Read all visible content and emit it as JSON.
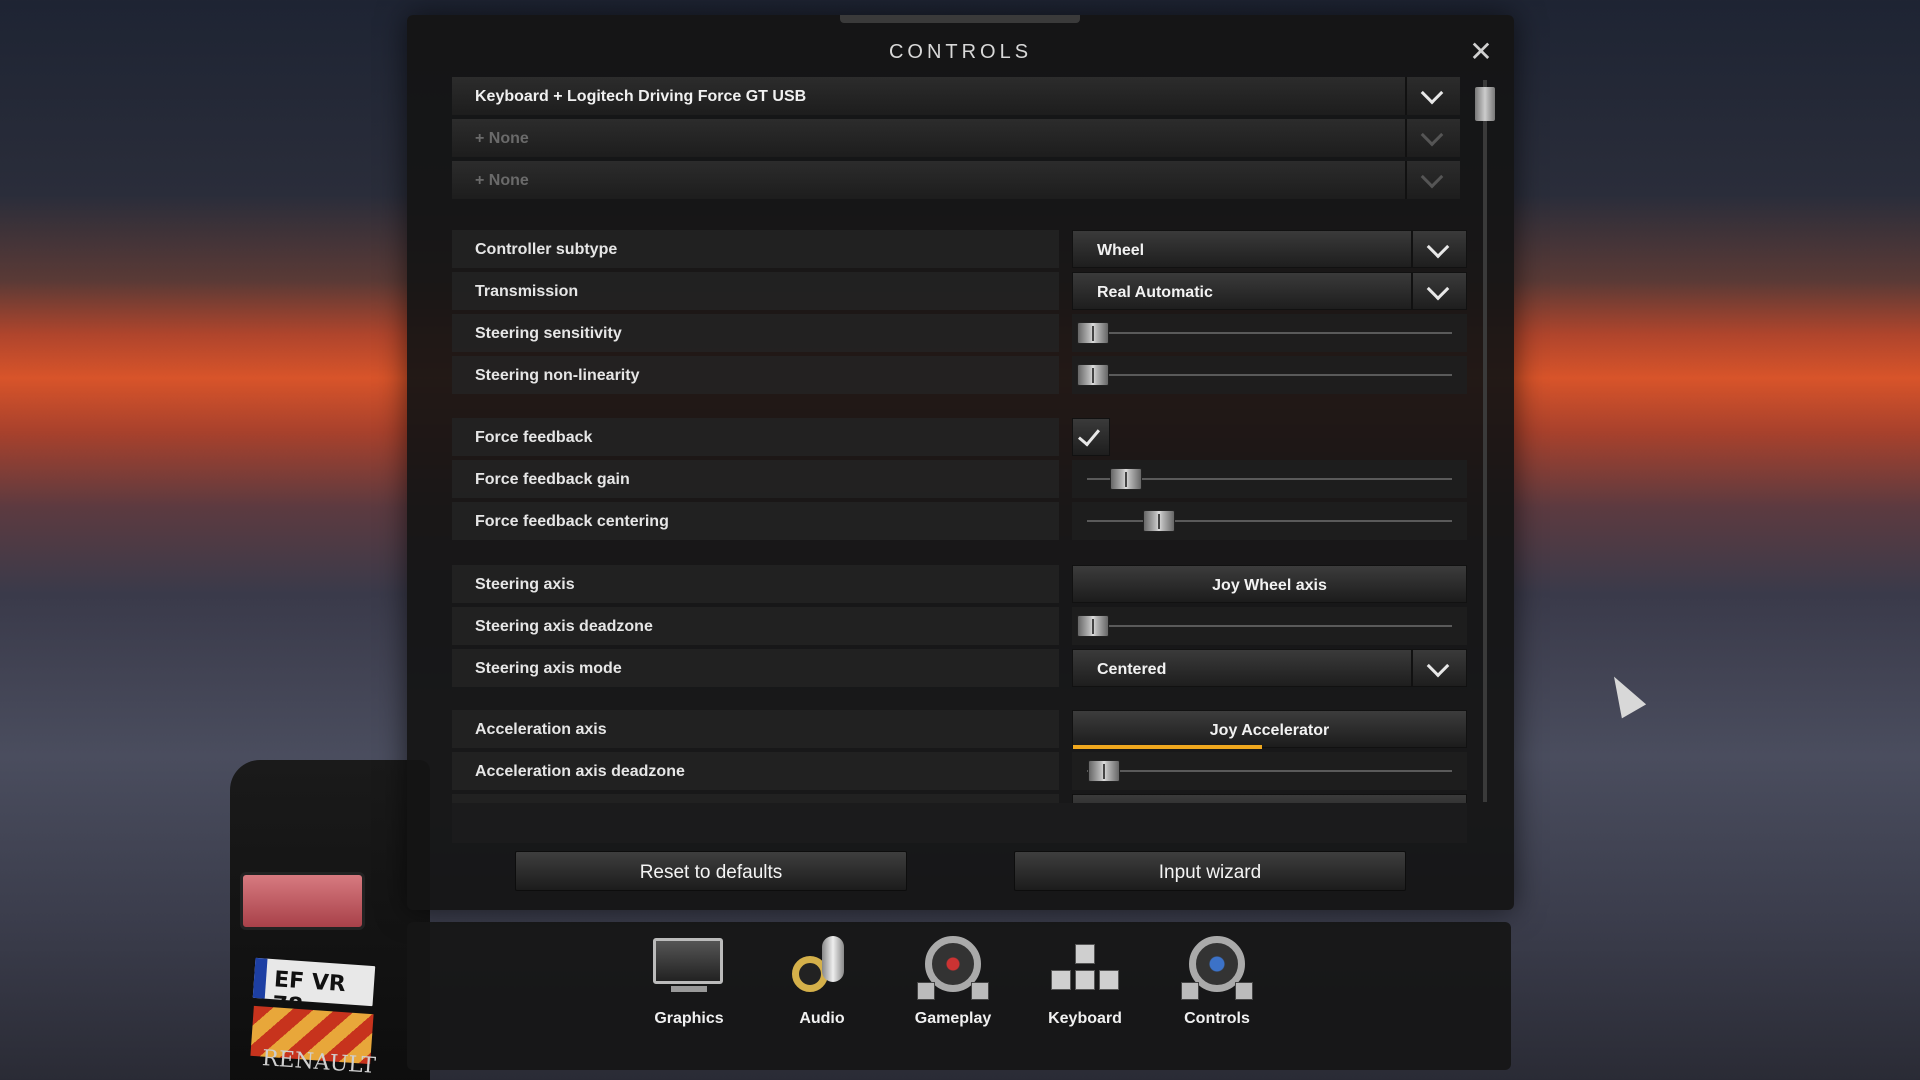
{
  "panel": {
    "title": "CONTROLS",
    "close_icon": "close-icon"
  },
  "devices": [
    {
      "label": "Keyboard + Logitech Driving Force GT USB",
      "active": true
    },
    {
      "label": "+ None",
      "active": false
    },
    {
      "label": "+ None",
      "active": false
    }
  ],
  "settings": {
    "controller_subtype": {
      "label": "Controller subtype",
      "value": "Wheel"
    },
    "transmission": {
      "label": "Transmission",
      "value": "Real Automatic"
    },
    "steering_sensitivity": {
      "label": "Steering sensitivity",
      "level": 0.0
    },
    "steering_nonlinearity": {
      "label": "Steering non-linearity",
      "level": 0.0
    },
    "force_feedback": {
      "label": "Force feedback",
      "checked": true
    },
    "force_feedback_gain": {
      "label": "Force feedback gain",
      "level": 0.09
    },
    "force_feedback_centering": {
      "label": "Force feedback centering",
      "level": 0.18
    },
    "steering_axis": {
      "label": "Steering axis",
      "value": "Joy Wheel axis"
    },
    "steering_axis_deadzone": {
      "label": "Steering axis deadzone",
      "level": 0.0
    },
    "steering_axis_mode": {
      "label": "Steering axis mode",
      "value": "Centered"
    },
    "acceleration_axis": {
      "label": "Acceleration axis",
      "value": "Joy Accelerator",
      "input_level": 0.48
    },
    "acceleration_axis_deadzone": {
      "label": "Acceleration axis deadzone",
      "level": 0.03
    }
  },
  "buttons": {
    "reset": "Reset to defaults",
    "wizard": "Input wizard"
  },
  "nav": [
    {
      "label": "Graphics",
      "icon": "monitor-icon"
    },
    {
      "label": "Audio",
      "icon": "microphone-icon"
    },
    {
      "label": "Gameplay",
      "icon": "steering-wheel-icon"
    },
    {
      "label": "Keyboard",
      "icon": "keyboard-icon"
    },
    {
      "label": "Controls",
      "icon": "wheel-pedals-icon"
    }
  ],
  "colors": {
    "accent_progress": "#f0a81e"
  }
}
